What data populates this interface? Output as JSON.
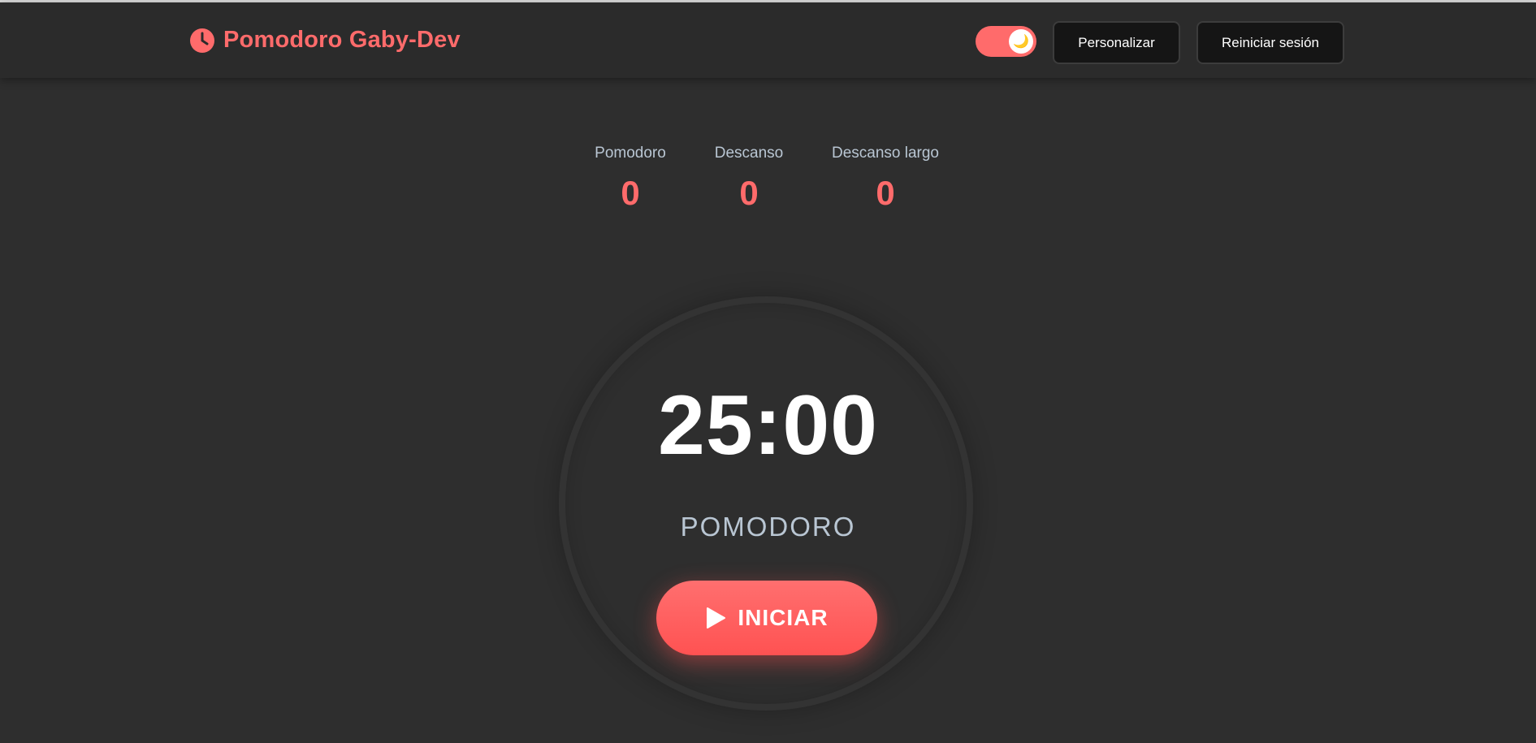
{
  "header": {
    "brand_title": "Pomodoro Gaby-Dev",
    "brand_icon": "clock-icon",
    "theme_toggle_icon": "moon-icon",
    "personalize_label": "Personalizar",
    "reset_session_label": "Reiniciar sesión"
  },
  "stats": [
    {
      "label": "Pomodoro",
      "value": "0"
    },
    {
      "label": "Descanso",
      "value": "0"
    },
    {
      "label": "Descanso largo",
      "value": "0"
    }
  ],
  "timer": {
    "time": "25:00",
    "mode": "POMODORO",
    "start_label": "INICIAR",
    "start_icon": "play-icon"
  },
  "colors": {
    "accent": "#ff6b6b",
    "background": "#2e2e2e",
    "header_bg": "#2b2b2b",
    "muted_text": "#b9c6d3"
  }
}
